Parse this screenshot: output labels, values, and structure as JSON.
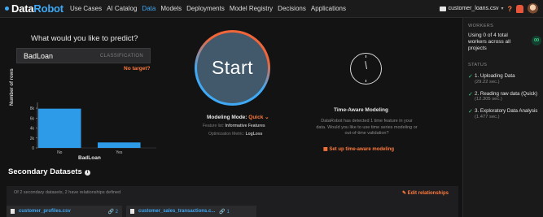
{
  "nav": {
    "brand_a": "Data",
    "brand_b": "Robot",
    "items": [
      "Use Cases",
      "AI Catalog",
      "Data",
      "Models",
      "Deployments",
      "Model Registry",
      "Decisions",
      "Applications"
    ],
    "active": "Data",
    "project_name": "customer_loans.csv",
    "help": "?"
  },
  "predict": {
    "title": "What would you like to predict?",
    "target_value": "BadLoan",
    "target_type": "CLASSIFICATION",
    "no_target": "No target?"
  },
  "chart_data": {
    "type": "bar",
    "categories": [
      "No",
      "Yes"
    ],
    "values": [
      7900,
      1100
    ],
    "xlabel": "BadLoan",
    "ylabel": "Number of rows",
    "yticks": [
      "0",
      "2k",
      "4k",
      "6k",
      "8k"
    ],
    "ylim": [
      0,
      8500
    ]
  },
  "start": {
    "label": "Start",
    "mode_label": "Modeling Mode:",
    "mode_value": "Quick",
    "feature_list_label": "Feature list:",
    "feature_list_value": "Informative Features",
    "metric_label": "Optimization Metric:",
    "metric_value": "LogLoss"
  },
  "time_aware": {
    "title": "Time-Aware Modeling",
    "desc": "DataRobot has detected 1 time feature in your data. Would you like to use time series modeling or out-of-time validation?",
    "link": "Set up time-aware modeling"
  },
  "secondary": {
    "title": "Secondary Datasets",
    "summary": "Of 2 secondary datasets, 2 have relationships defined",
    "edit": "Edit relationships",
    "datasets": [
      {
        "name": "customer_profiles.csv",
        "count": "2"
      },
      {
        "name": "customer_sales_transactions.c...",
        "count": "1"
      }
    ]
  },
  "workers": {
    "heading": "WORKERS",
    "text": "Using 0 of 4 total workers across all projects",
    "badge": "00"
  },
  "status": {
    "heading": "STATUS",
    "steps": [
      {
        "name": "1. Uploading Data",
        "time": "(29.22 sec.)"
      },
      {
        "name": "2. Reading raw data (Quick)",
        "time": "(12.305 sec.)"
      },
      {
        "name": "3. Exploratory Data Analysis",
        "time": "(1.477 sec.)"
      }
    ]
  },
  "colors": {
    "accent_blue": "#3fa9f5",
    "accent_orange": "#ff7a3d",
    "success_green": "#3fd08a"
  }
}
